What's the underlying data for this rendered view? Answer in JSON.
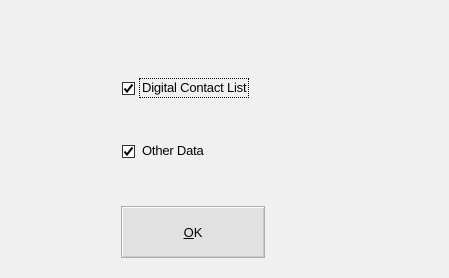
{
  "checkboxes": [
    {
      "label": "Digital Contact List",
      "checked": true,
      "focused": true
    },
    {
      "label": "Other Data",
      "checked": true,
      "focused": false
    }
  ],
  "ok_button": {
    "mnemonic": "O",
    "rest": "K"
  },
  "icons": {
    "check": "checkmark-icon"
  }
}
